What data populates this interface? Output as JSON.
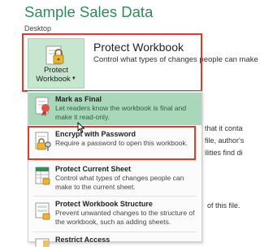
{
  "window": {
    "title": "Sample Sales Data",
    "location": "Desktop"
  },
  "protect_workbook": {
    "button_label_line1": "Protect",
    "button_label_line2": "Workbook",
    "heading": "Protect Workbook",
    "description": "Control what types of changes people can make"
  },
  "menu": {
    "items": [
      {
        "title": "Mark as Final",
        "description": "Let readers know the workbook is final and make it read-only."
      },
      {
        "title": "Encrypt with Password",
        "description": "Require a password to open this workbook."
      },
      {
        "title": "Protect Current Sheet",
        "description": "Control what types of changes people can make to the current sheet."
      },
      {
        "title": "Protect Workbook Structure",
        "description": "Prevent unwanted changes to the structure of the workbook, such as adding sheets."
      },
      {
        "title": "Restrict Access",
        "description": ""
      }
    ]
  },
  "background_text": {
    "line1": "that it conta",
    "line2": "file, author's",
    "line3": "ilities find di",
    "line4": "of this file."
  },
  "colors": {
    "accent": "#2f8a5a",
    "highlight": "#a8d8b9",
    "annotation": "#e03a2a"
  },
  "icons": [
    "lock-icon",
    "ribbon-icon",
    "key-lock-icon",
    "sheet-icon",
    "workbook-icon",
    "restrict-icon"
  ]
}
